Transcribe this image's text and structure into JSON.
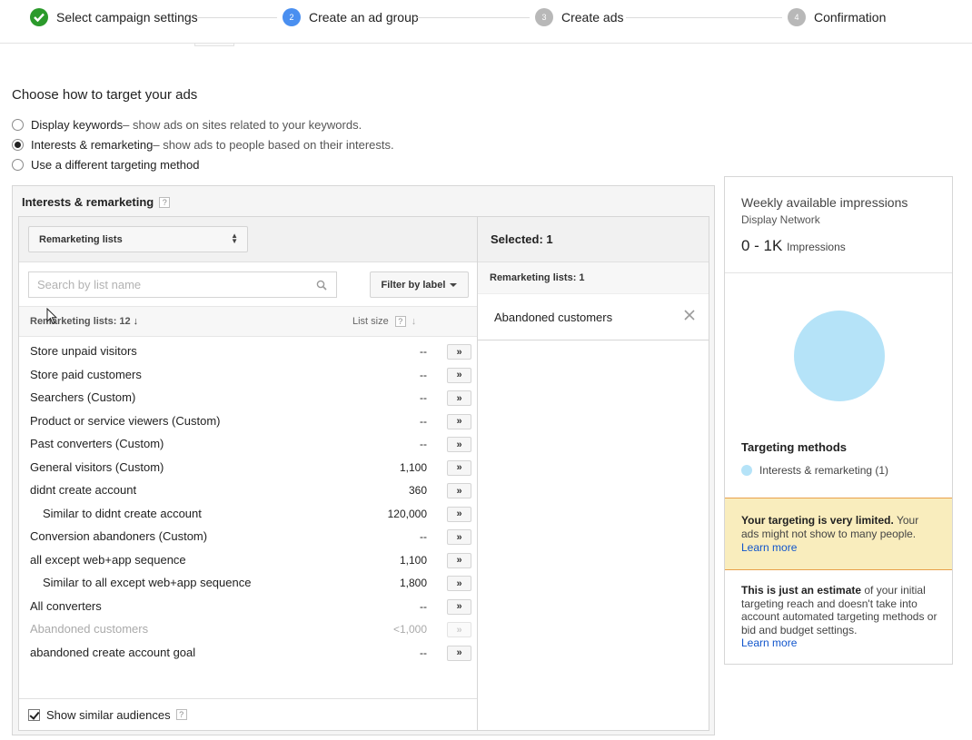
{
  "stepper": {
    "steps": [
      {
        "label": "Select campaign settings",
        "number": "",
        "state": "done"
      },
      {
        "label": "Create an ad group",
        "number": "2",
        "state": "active"
      },
      {
        "label": "Create ads",
        "number": "3",
        "state": "todo"
      },
      {
        "label": "Confirmation",
        "number": "4",
        "state": "todo"
      }
    ]
  },
  "targeting": {
    "heading": "Choose how to target your ads",
    "options": [
      {
        "label": "Display keywords",
        "desc": " – show ads on sites related to your keywords.",
        "checked": false
      },
      {
        "label": "Interests & remarketing",
        "desc": " – show ads to people based on their interests.",
        "checked": true
      },
      {
        "label": "Use a different targeting method",
        "desc": "",
        "checked": false
      }
    ]
  },
  "panel": {
    "title": "Interests & remarketing",
    "help": "?",
    "category_select": "Remarketing lists",
    "search_placeholder": "Search by list name",
    "filter_label": "Filter by label",
    "col_name": "Remarketing lists: 12",
    "col_size": "List size",
    "add_label": "»",
    "rows": [
      {
        "name": "Store unpaid visitors",
        "size": "--",
        "indent": false,
        "disabled": false
      },
      {
        "name": "Store paid customers",
        "size": "--",
        "indent": false,
        "disabled": false
      },
      {
        "name": "Searchers (Custom)",
        "size": "--",
        "indent": false,
        "disabled": false
      },
      {
        "name": "Product or service viewers (Custom)",
        "size": "--",
        "indent": false,
        "disabled": false
      },
      {
        "name": "Past converters (Custom)",
        "size": "--",
        "indent": false,
        "disabled": false
      },
      {
        "name": "General visitors (Custom)",
        "size": "1,100",
        "indent": false,
        "disabled": false
      },
      {
        "name": "didnt create account",
        "size": "360",
        "indent": false,
        "disabled": false
      },
      {
        "name": "Similar to didnt create account",
        "size": "120,000",
        "indent": true,
        "disabled": false
      },
      {
        "name": "Conversion abandoners (Custom)",
        "size": "--",
        "indent": false,
        "disabled": false
      },
      {
        "name": "all except web+app sequence",
        "size": "1,100",
        "indent": false,
        "disabled": false
      },
      {
        "name": "Similar to all except web+app sequence",
        "size": "1,800",
        "indent": true,
        "disabled": false
      },
      {
        "name": "All converters",
        "size": "--",
        "indent": false,
        "disabled": false
      },
      {
        "name": "Abandoned customers",
        "size": "<1,000",
        "indent": false,
        "disabled": true
      },
      {
        "name": "abandoned create account goal",
        "size": "--",
        "indent": false,
        "disabled": false
      }
    ],
    "show_similar": "Show similar audiences",
    "selected_header": "Selected: 1",
    "selected_sub": "Remarketing lists: 1",
    "selected_item": "Abandoned customers"
  },
  "estimate": {
    "title": "Weekly available impressions",
    "network": "Display Network",
    "range": "0 - 1K",
    "unit": "Impressions",
    "methods_title": "Targeting methods",
    "method_item": "Interests & remarketing (1)",
    "warning_bold": "Your targeting is very limited.",
    "warning_text": " Your ads might not show to many people. ",
    "warning_link": "Learn more",
    "note_bold": "This is just an estimate",
    "note_text": " of your initial targeting reach and doesn't take into account automated targeting methods or bid and budget settings.",
    "note_link": "Learn more",
    "colors": {
      "accent": "#4a8ff0",
      "done": "#2b9a2b",
      "bubble": "#b5e3f8",
      "warning_bg": "#f9edbd",
      "link": "#1155cc"
    }
  }
}
